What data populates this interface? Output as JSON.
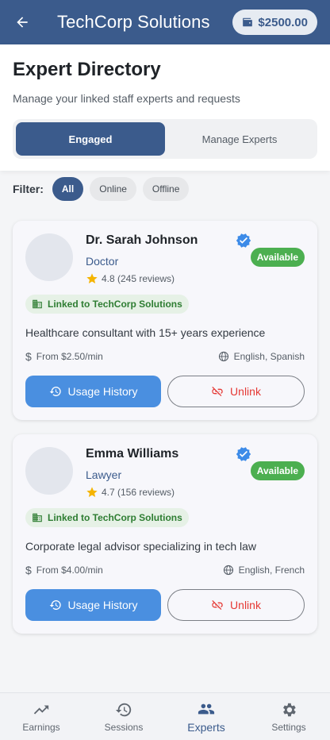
{
  "appbar": {
    "title": "TechCorp Solutions",
    "wallet": "$2500.00"
  },
  "header": {
    "title": "Expert Directory",
    "subtitle": "Manage your linked staff experts and requests",
    "tabs": [
      {
        "label": "Engaged"
      },
      {
        "label": "Manage Experts"
      }
    ]
  },
  "filter": {
    "label": "Filter:",
    "chips": [
      {
        "label": "All"
      },
      {
        "label": "Online"
      },
      {
        "label": "Offline"
      }
    ]
  },
  "experts": [
    {
      "name": "Dr. Sarah Johnson",
      "role": "Doctor",
      "rating": "4.8 (245 reviews)",
      "status": "Available",
      "linked": "Linked to TechCorp Solutions",
      "description": "Healthcare consultant with 15+ years experience",
      "rate": "From $2.50/min",
      "languages": "English, Spanish",
      "usage_label": "Usage History",
      "unlink_label": "Unlink"
    },
    {
      "name": "Emma Williams",
      "role": "Lawyer",
      "rating": "4.7 (156 reviews)",
      "status": "Available",
      "linked": "Linked to TechCorp Solutions",
      "description": "Corporate legal advisor specializing in tech law",
      "rate": "From $4.00/min",
      "languages": "English, French",
      "usage_label": "Usage History",
      "unlink_label": "Unlink"
    }
  ],
  "nav": {
    "items": [
      {
        "label": "Earnings",
        "icon": "trending-up-icon"
      },
      {
        "label": "Sessions",
        "icon": "history-icon"
      },
      {
        "label": "Experts",
        "icon": "people-icon"
      },
      {
        "label": "Settings",
        "icon": "gear-icon"
      }
    ]
  },
  "colors": {
    "primary": "#3b5b8c",
    "available": "#4caf50",
    "unlink": "#e53935",
    "usage": "#4a8fe0"
  }
}
